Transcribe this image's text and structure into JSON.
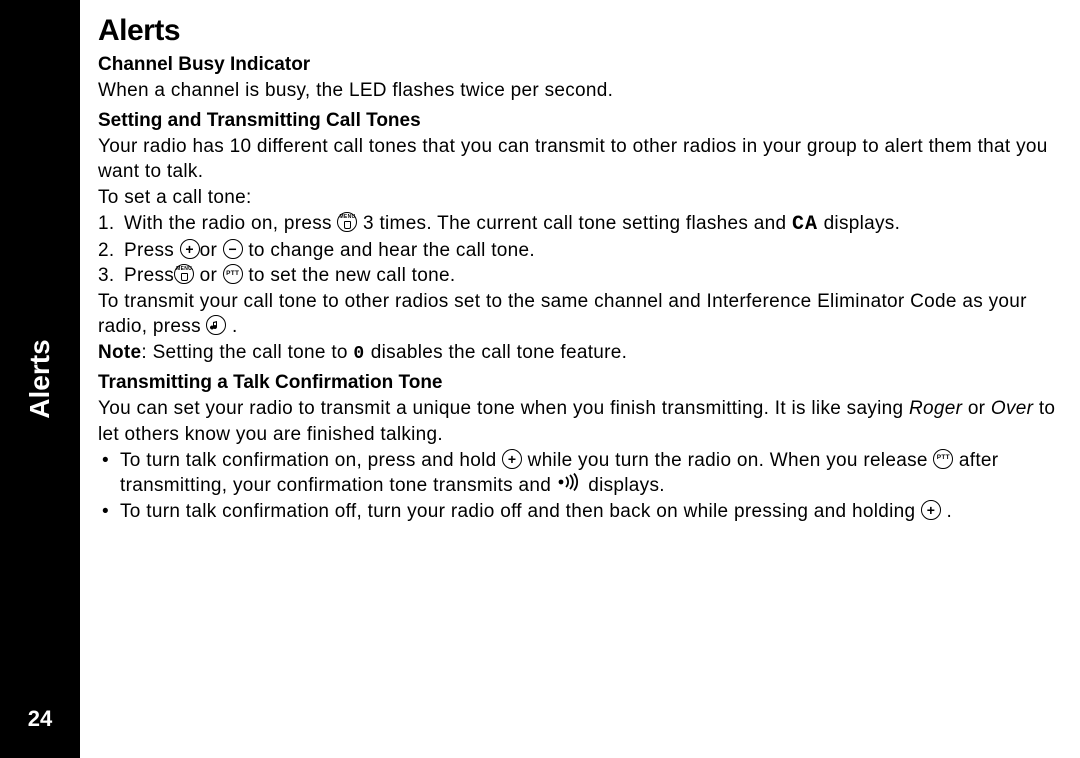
{
  "sidebar": {
    "label": "Alerts",
    "page_number": "24"
  },
  "title": "Alerts",
  "s1": {
    "heading": "Channel Busy Indicator",
    "body": "When a channel is busy, the LED flashes twice per second."
  },
  "s2": {
    "heading": "Setting and Transmitting Call Tones",
    "intro": "Your radio has 10 different call tones that you can transmit to other radios in your group to alert them that you want to talk.",
    "lead": "To set a call tone:",
    "step1a": "With the radio on, press ",
    "step1b": " 3 times. The current call tone setting flashes and ",
    "step1c": " displays.",
    "step2a": "Press ",
    "step2b": "or ",
    "step2c": " to change and hear the call tone.",
    "step3a": "Press",
    "step3b": " or ",
    "step3c": "  to set the new call tone.",
    "tx_a": "To transmit your call tone to other radios set to the same channel and Interference Eliminator Code as your radio, press  ",
    "tx_b": " .",
    "note_label": "Note",
    "note_a": ": Setting the call tone to  ",
    "note_b": "  disables the call tone feature.",
    "ca_glyph": "CA",
    "zero_glyph": "0"
  },
  "s3": {
    "heading": "Transmitting a Talk Confirmation Tone",
    "intro_a": "You can set your radio to transmit a unique tone when you finish transmitting. It is like saying ",
    "roger": "Roger",
    "intro_b": " or ",
    "over": "Over",
    "intro_c": " to let others know you are finished talking.",
    "b1a": "To turn talk confirmation on, press and hold ",
    "b1b": " while you turn the radio on. When you release ",
    "b1c": " after transmitting, your confirmation tone transmits and ",
    "b1d": " displays.",
    "b2a": "To turn talk confirmation off, turn your radio off and then back on while pressing and holding ",
    "b2b": " ."
  }
}
